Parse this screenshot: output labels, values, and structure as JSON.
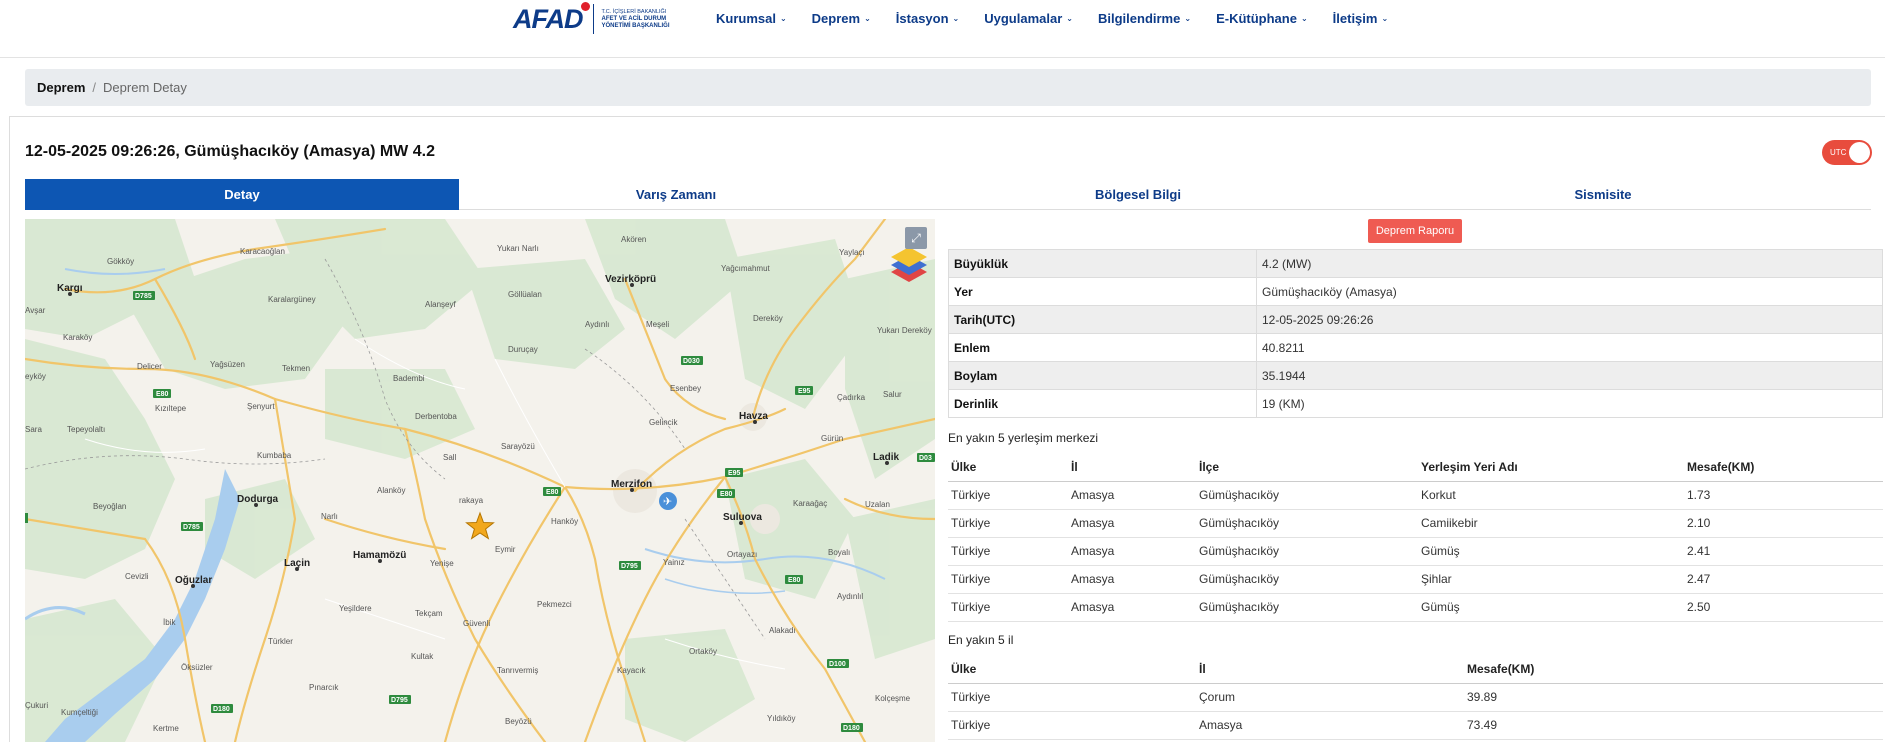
{
  "header": {
    "logo_text": "AFAD",
    "logo_sub1": "T.C. İÇİŞLERİ BAKANLIĞI",
    "logo_sub2": "AFET VE ACİL DURUM",
    "logo_sub3": "YÖNETİMİ BAŞKANLIĞI",
    "nav": [
      "Kurumsal",
      "Deprem",
      "İstasyon",
      "Uygulamalar",
      "Bilgilendirme",
      "E-Kütüphane",
      "İletişim"
    ]
  },
  "breadcrumb": {
    "parent": "Deprem",
    "current": "Deprem Detay"
  },
  "event_title": "12-05-2025 09:26:26, Gümüşhacıköy (Amasya) MW 4.2",
  "utc_label": "UTC",
  "tabs": [
    "Detay",
    "Varış Zamanı",
    "Bölgesel Bilgi",
    "Sismisite"
  ],
  "report_button": "Deprem Raporu",
  "details": [
    {
      "key": "Büyüklük",
      "value": "4.2 (MW)"
    },
    {
      "key": "Yer",
      "value": "Gümüşhacıköy (Amasya)"
    },
    {
      "key": "Tarih(UTC)",
      "value": "12-05-2025 09:26:26"
    },
    {
      "key": "Enlem",
      "value": "40.8211"
    },
    {
      "key": "Boylam",
      "value": "35.1944"
    },
    {
      "key": "Derinlik",
      "value": "19 (KM)"
    }
  ],
  "nearest_settlements": {
    "title": "En yakın 5 yerleşim merkezi",
    "headers": [
      "Ülke",
      "İl",
      "İlçe",
      "Yerleşim Yeri Adı",
      "Mesafe(KM)"
    ],
    "rows": [
      [
        "Türkiye",
        "Amasya",
        "Gümüşhacıköy",
        "Korkut",
        "1.73"
      ],
      [
        "Türkiye",
        "Amasya",
        "Gümüşhacıköy",
        "Camiikebir",
        "2.10"
      ],
      [
        "Türkiye",
        "Amasya",
        "Gümüşhacıköy",
        "Gümüş",
        "2.41"
      ],
      [
        "Türkiye",
        "Amasya",
        "Gümüşhacıköy",
        "Şihlar",
        "2.47"
      ],
      [
        "Türkiye",
        "Amasya",
        "Gümüşhacıköy",
        "Gümüş",
        "2.50"
      ]
    ]
  },
  "nearest_provinces": {
    "title": "En yakın 5 il",
    "headers": [
      "Ülke",
      "İl",
      "Mesafe(KM)"
    ],
    "rows": [
      [
        "Türkiye",
        "Çorum",
        "39.89"
      ],
      [
        "Türkiye",
        "Amasya",
        "73.49"
      ]
    ]
  },
  "map": {
    "labels_major": [
      "Kargı",
      "Vezirköprü",
      "Havza",
      "Merzifon",
      "Suluova",
      "Ladik",
      "Dodurga",
      "Hamamözü",
      "Laçin",
      "Oğuzlar"
    ],
    "labels_minor": [
      "Karacaoğlan",
      "Gökköy",
      "Karalargüney",
      "Avşar",
      "Karaköy",
      "Delicer",
      "Yağsüzen",
      "Tekmen",
      "Eyköy",
      "Kızıltepe",
      "Şenyurt",
      "Sara",
      "Tepeyolaltı",
      "Kumbaba",
      "Beyoğlan",
      "Yukarı Narlı",
      "Alanşeyf",
      "Göllüalan",
      "Akören",
      "Yağcımahmut",
      "Yaylaçı",
      "Aydınlı",
      "Meşeli",
      "Dereköy",
      "Yukarı Dereköy",
      "Duruçay",
      "Badembi",
      "Esenbey",
      "Çadırka",
      "Salur",
      "Gelincik",
      "Derbentoba",
      "Sarayözü",
      "Gelinsini",
      "Gürün",
      "Sall",
      "Alanköy",
      "rakaya",
      "Hanköy",
      "Karaağaç",
      "Uzalan",
      "Narlı",
      "Eymir",
      "Yenişe",
      "Yainız",
      "Ortayazı",
      "Boyalı",
      "Cevizli",
      "İbik",
      "Yeşildere",
      "Tekçam",
      "Güvenli",
      "Pekmezci",
      "Alakadı",
      "Aydınlıl",
      "Türkler",
      "Kultak",
      "Ortaköy",
      "Öksüzler",
      "Pınarcık",
      "Tanrıvermiş",
      "Kayacık",
      "Çukuri",
      "Kumçeltiği",
      "Kertme",
      "Beyözü",
      "Yıldıköy",
      "Kolçeşme"
    ],
    "road_shields": [
      "D785",
      "E80",
      "D785",
      "D030",
      "E95",
      "E80",
      "E95",
      "E80",
      "D795",
      "E80",
      "D795",
      "D100",
      "D180",
      "D180",
      "D03"
    ]
  }
}
